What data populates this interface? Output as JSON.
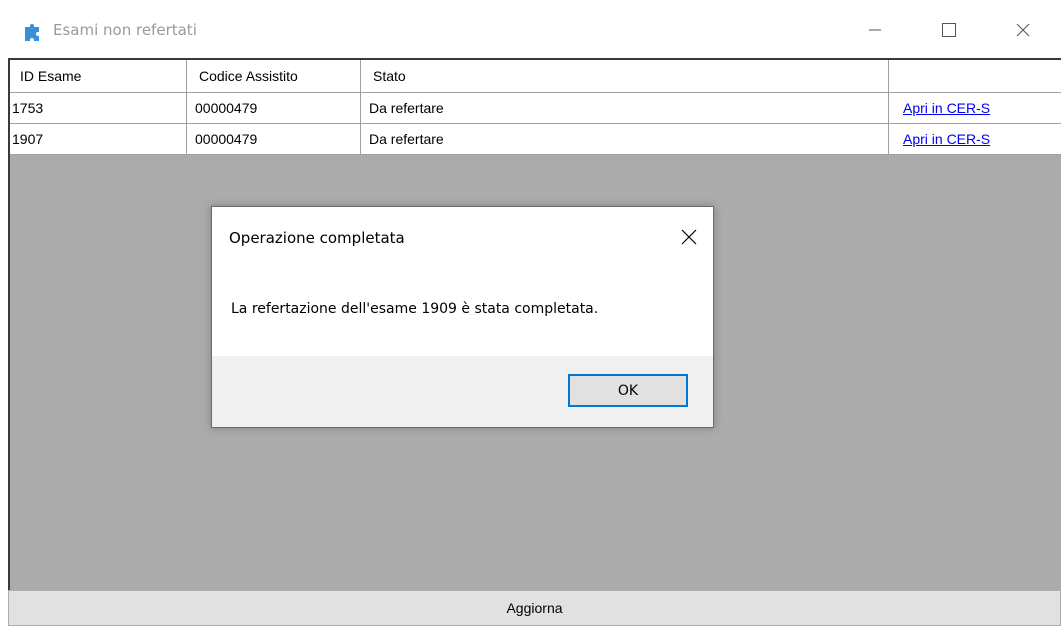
{
  "window": {
    "title": "Esami non refertati",
    "app_icon": "puzzle-icon",
    "controls": {
      "minimize_icon": "minimize-icon",
      "maximize_icon": "maximize-icon",
      "close_icon": "close-icon"
    }
  },
  "grid": {
    "columns": [
      "ID Esame",
      "Codice Assistito",
      "Stato",
      ""
    ],
    "rows": [
      {
        "id": "1753",
        "codice": "00000479",
        "stato": "Da refertare",
        "action": "Apri in CER-S"
      },
      {
        "id": "1907",
        "codice": "00000479",
        "stato": "Da refertare",
        "action": "Apri in CER-S"
      }
    ]
  },
  "refresh_button": {
    "label": "Aggiorna"
  },
  "dialog": {
    "title": "Operazione completata",
    "message": "La refertazione dell'esame 1909 è stata completata.",
    "ok_label": "OK",
    "close_icon": "close-icon"
  },
  "colors": {
    "accent": "#0078d7",
    "link": "#0000ee",
    "grid_background": "#ababab",
    "app_icon": "#3a8fd6"
  }
}
